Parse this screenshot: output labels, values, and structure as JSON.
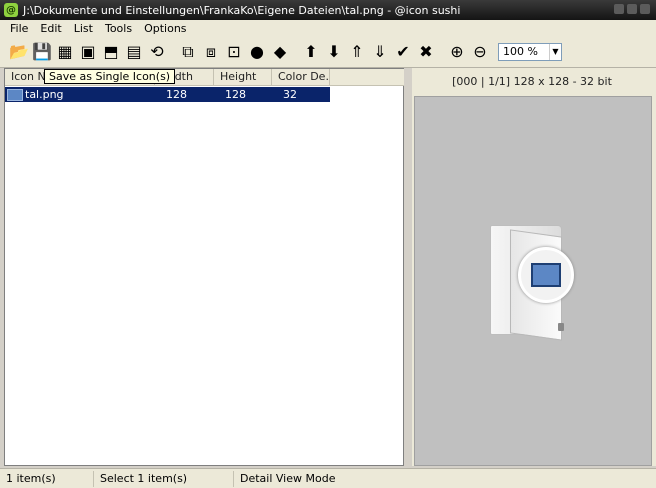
{
  "window": {
    "title": "J:\\Dokumente und Einstellungen\\FrankaKo\\Eigene Dateien\\tal.png - @icon sushi"
  },
  "menu": [
    {
      "label": "File"
    },
    {
      "label": "Edit"
    },
    {
      "label": "List"
    },
    {
      "label": "Tools"
    },
    {
      "label": "Options"
    }
  ],
  "toolbar": {
    "zoom_value": "100 %",
    "buttons": [
      {
        "name": "open-icon",
        "glyph": "📂"
      },
      {
        "name": "save-icon",
        "glyph": "💾"
      },
      {
        "name": "save-all-icon",
        "glyph": "▦"
      },
      {
        "name": "save-as-single-icon",
        "glyph": "▣"
      },
      {
        "name": "export-icon",
        "glyph": "⬒"
      },
      {
        "name": "png-icon",
        "glyph": "▤"
      },
      {
        "name": "refresh-icon",
        "glyph": "⟲"
      }
    ],
    "buttons2": [
      {
        "name": "copy-icon",
        "glyph": "⧉"
      },
      {
        "name": "paste-icon",
        "glyph": "⧈"
      },
      {
        "name": "paste-new-icon",
        "glyph": "⊡"
      },
      {
        "name": "user-black-icon",
        "glyph": "●"
      },
      {
        "name": "user-green-icon",
        "glyph": "◆"
      }
    ],
    "buttons3": [
      {
        "name": "move-up-icon",
        "glyph": "⬆"
      },
      {
        "name": "move-down-icon",
        "glyph": "⬇"
      },
      {
        "name": "move-top-icon",
        "glyph": "⇑"
      },
      {
        "name": "move-bottom-icon",
        "glyph": "⇓"
      },
      {
        "name": "check-icon",
        "glyph": "✔"
      },
      {
        "name": "delete-icon",
        "glyph": "✖"
      }
    ],
    "buttons4": [
      {
        "name": "zoom-in-icon",
        "glyph": "⊕"
      },
      {
        "name": "zoom-out-icon",
        "glyph": "⊖"
      }
    ]
  },
  "tooltip": "Save as Single Icon(s)",
  "list": {
    "columns": [
      "Icon Na",
      "Width",
      "Height",
      "Color De..."
    ],
    "rows": [
      {
        "name": "tal.png",
        "width": "128",
        "height": "128",
        "color_depth": "32"
      }
    ]
  },
  "preview": {
    "info": "[000 | 1/1] 128 x 128 - 32 bit"
  },
  "status": {
    "items": "1 item(s)",
    "selected": "Select 1 item(s)",
    "mode": "Detail View Mode"
  },
  "colors": {
    "selection": "#0a246a",
    "titlebar": "#1e1e1e",
    "preview_bg": "#c0c0c0"
  }
}
